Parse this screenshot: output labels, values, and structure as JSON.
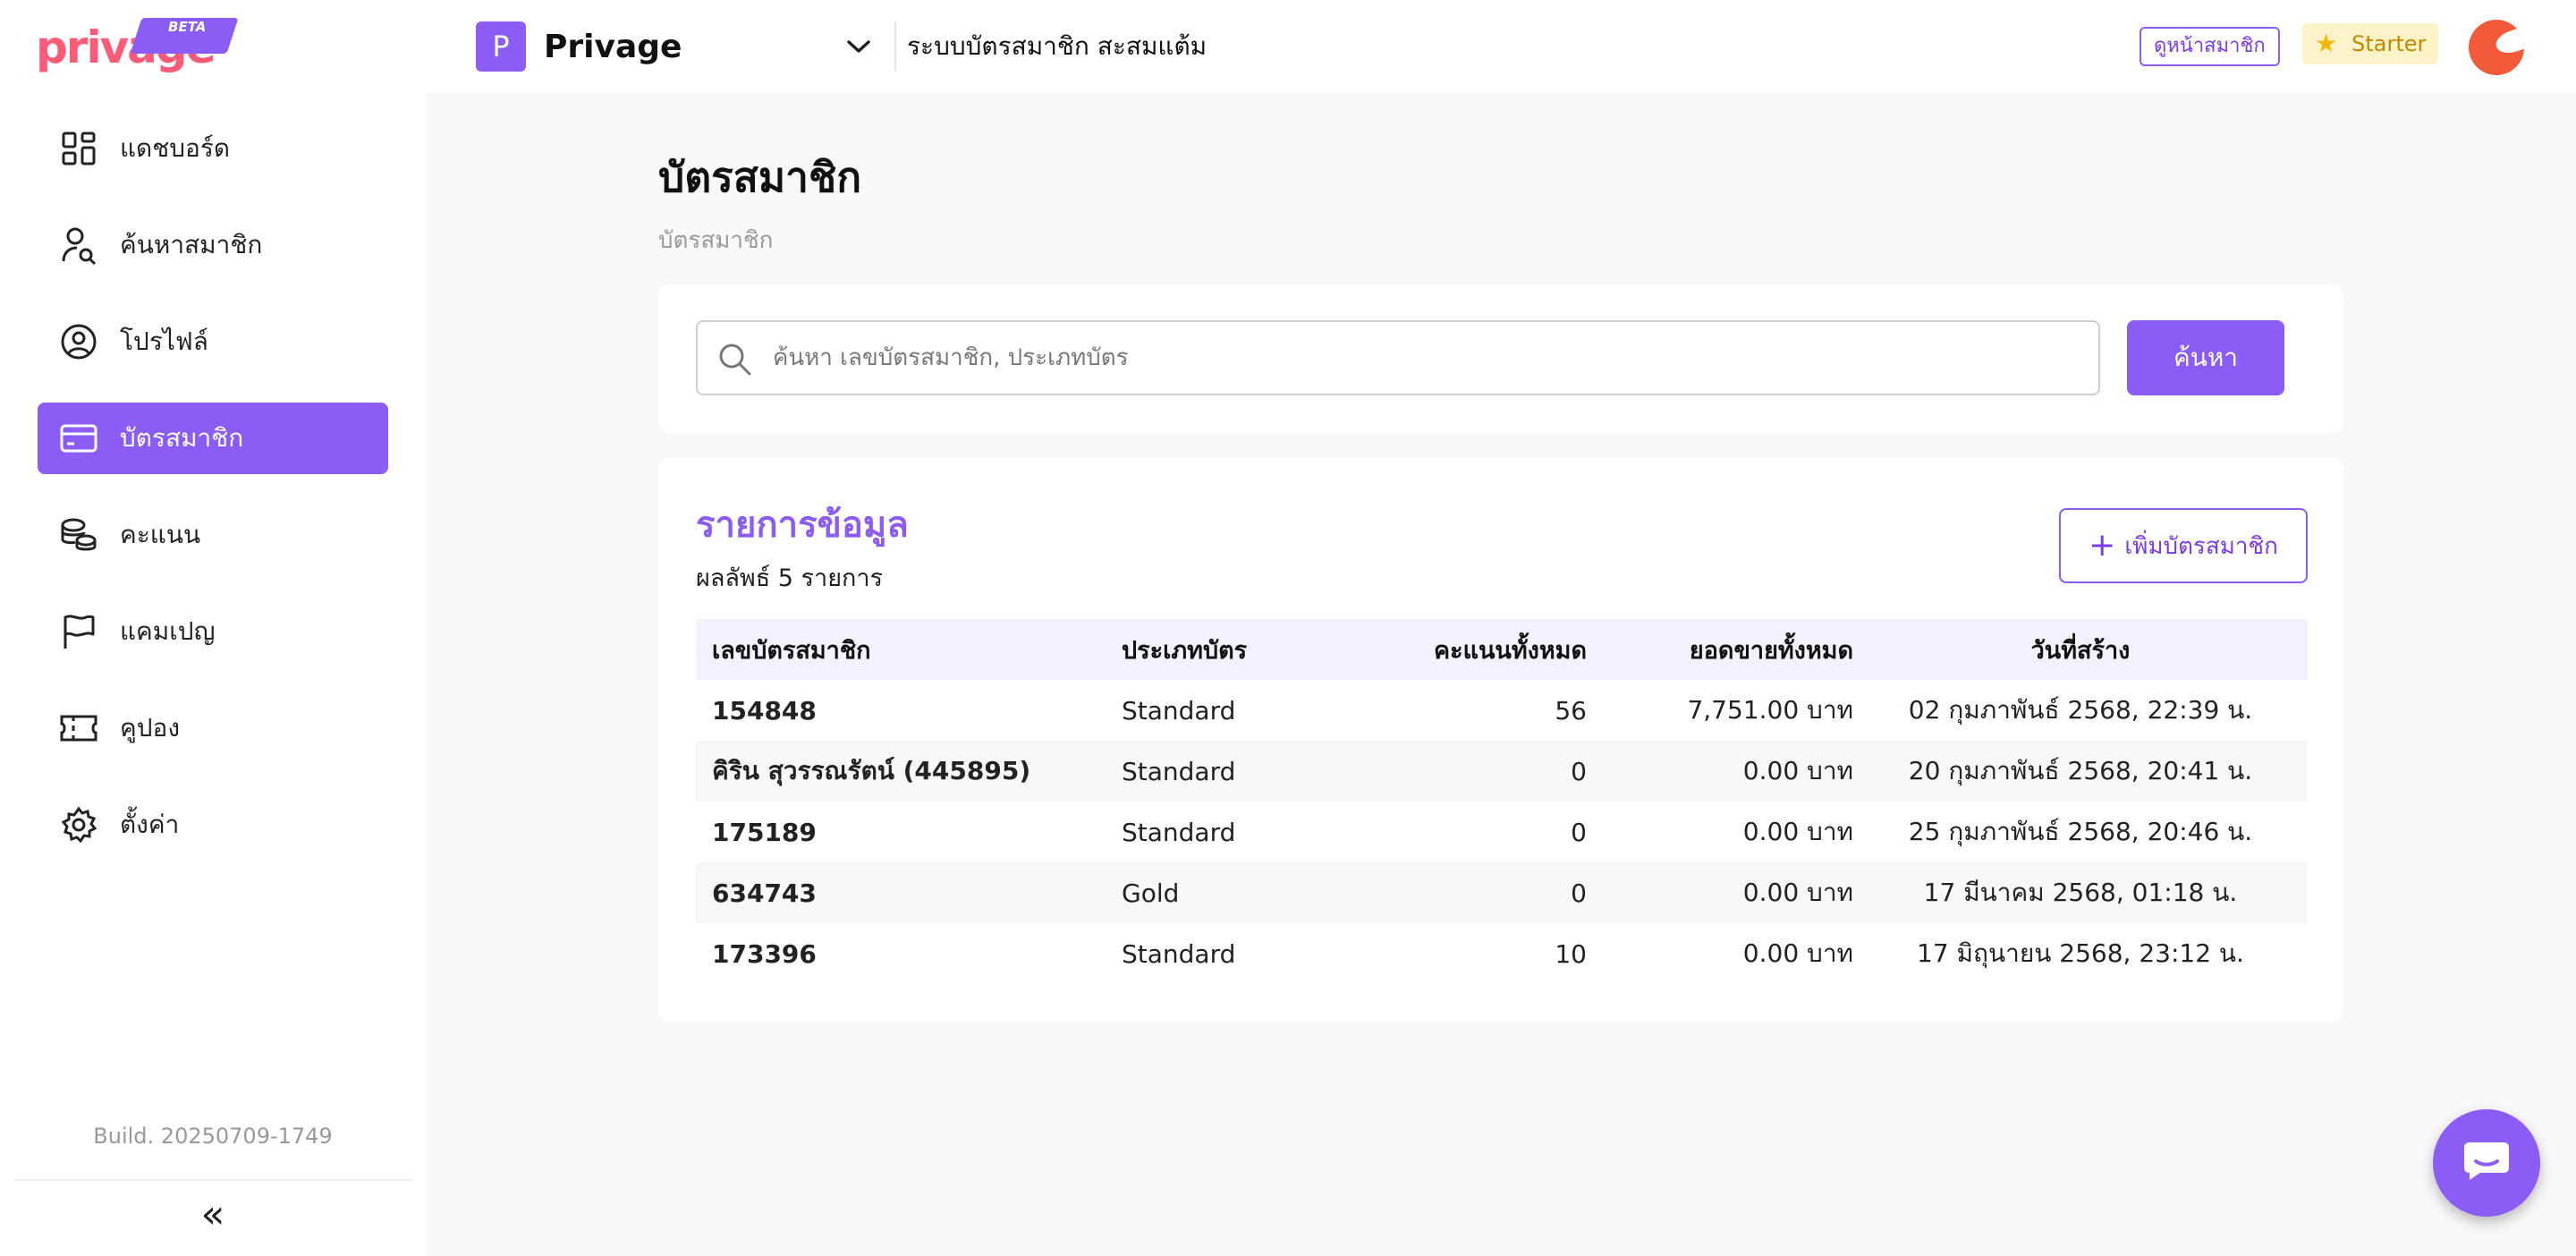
{
  "header": {
    "logo_text": "privage",
    "logo_badge": "BETA",
    "brand_initial": "P",
    "brand_name": "Privage",
    "system_title": "ระบบบัตรสมาชิก สะสมแต้ม",
    "view_member_label": "ดูหน้าสมาชิก",
    "plan_label": "Starter",
    "plan_icon": "star-icon"
  },
  "sidebar": {
    "items": [
      {
        "label": "แดชบอร์ด",
        "icon": "dashboard-icon",
        "active": false
      },
      {
        "label": "ค้นหาสมาชิก",
        "icon": "user-search-icon",
        "active": false
      },
      {
        "label": "โปรไฟล์",
        "icon": "profile-icon",
        "active": false
      },
      {
        "label": "บัตรสมาชิก",
        "icon": "card-icon",
        "active": true
      },
      {
        "label": "คะแนน",
        "icon": "coins-icon",
        "active": false
      },
      {
        "label": "แคมเปญ",
        "icon": "flag-icon",
        "active": false
      },
      {
        "label": "คูปอง",
        "icon": "ticket-icon",
        "active": false
      },
      {
        "label": "ตั้งค่า",
        "icon": "gear-icon",
        "active": false
      }
    ],
    "build": "Build. 20250709-1749",
    "collapse_label": "«"
  },
  "main": {
    "title": "บัตรสมาชิก",
    "breadcrumb": "บัตรสมาชิก",
    "search": {
      "placeholder": "ค้นหา เลขบัตรสมาชิก, ประเภทบัตร",
      "value": "",
      "button_label": "ค้นหา"
    },
    "list": {
      "title": "รายการข้อมูล",
      "count_text": "ผลลัพธ์ 5 รายการ",
      "add_label": "เพิ่มบัตรสมาชิก",
      "columns": [
        "เลขบัตรสมาชิก",
        "ประเภทบัตร",
        "คะแนนทั้งหมด",
        "ยอดขายทั้งหมด",
        "วันที่สร้าง"
      ],
      "rows": [
        [
          "154848",
          "Standard",
          "56",
          "7,751.00 บาท",
          "02 กุมภาพันธ์ 2568, 22:39 น."
        ],
        [
          "คิริน สุวรรณรัตน์ (445895)",
          "Standard",
          "0",
          "0.00 บาท",
          "20 กุมภาพันธ์ 2568, 20:41 น."
        ],
        [
          "175189",
          "Standard",
          "0",
          "0.00 บาท",
          "25 กุมภาพันธ์ 2568, 20:46 น."
        ],
        [
          "634743",
          "Gold",
          "0",
          "0.00 บาท",
          "17 มีนาคม 2568, 01:18 น."
        ],
        [
          "173396",
          "Standard",
          "10",
          "0.00 บาท",
          "17 มิถุนายน 2568, 23:12 น."
        ]
      ]
    }
  },
  "colors": {
    "accent": "#8b5cf6",
    "logo": "#ff5a78",
    "avatar": "#f25a3a",
    "plan_bg": "#fdf3c8"
  }
}
